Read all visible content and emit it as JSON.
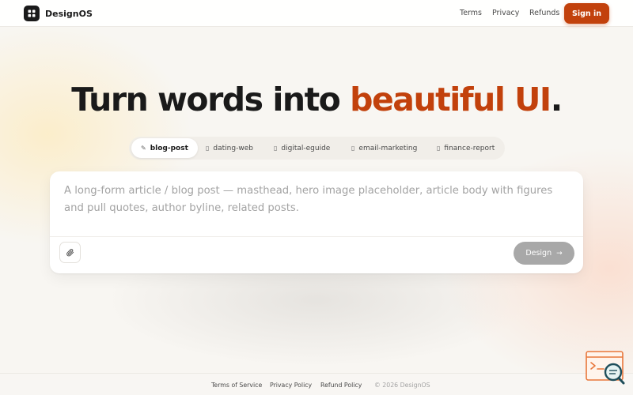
{
  "app": {
    "name": "DesignOS",
    "accent_color": "#c2410c",
    "logo_icon": "grid-icon"
  },
  "header": {
    "nav": [
      {
        "label": "Terms"
      },
      {
        "label": "Privacy"
      },
      {
        "label": "Refunds"
      }
    ],
    "signin_label": "Sign in"
  },
  "hero": {
    "title_prefix": "Turn words into ",
    "title_accent": "beautiful UI",
    "title_suffix": "."
  },
  "templates": {
    "selected": "blog-post",
    "tabs": [
      {
        "label": "blog-post",
        "icon": "pencil-icon"
      },
      {
        "label": "dating-web",
        "icon": "placeholder-icon"
      },
      {
        "label": "digital-eguide",
        "icon": "placeholder-icon"
      },
      {
        "label": "email-marketing",
        "icon": "placeholder-icon"
      },
      {
        "label": "finance-report",
        "icon": "placeholder-icon"
      }
    ]
  },
  "prompt": {
    "text": "A long-form article / blog post — masthead, hero image placeholder, article body with figures and pull quotes, author byline, related posts.",
    "attach_icon": "paperclip-icon",
    "design_label": "Design",
    "design_icon": "arrow-right-icon"
  },
  "footer": {
    "links": [
      {
        "label": "Terms of Service"
      },
      {
        "label": "Privacy Policy"
      },
      {
        "label": "Refund Policy"
      }
    ],
    "copyright": "© 2026 DesignOS"
  },
  "widget": {
    "icon": "code-search-icon",
    "color": "#e8763a"
  }
}
